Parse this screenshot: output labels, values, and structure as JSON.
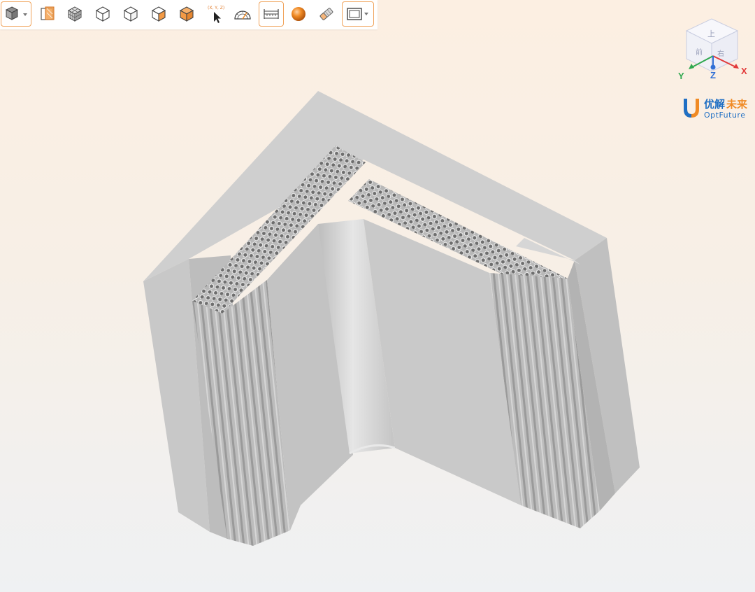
{
  "toolbar": {
    "buttons": [
      {
        "id": "view-cube",
        "icon": "cube-view-icon",
        "dropdown": true
      },
      {
        "id": "section-view",
        "icon": "section-plane-icon"
      },
      {
        "id": "mesh-view",
        "icon": "wireframe-cube-icon"
      },
      {
        "id": "view-front",
        "icon": "cube-outline-icon"
      },
      {
        "id": "view-back",
        "icon": "cube-outline-icon"
      },
      {
        "id": "view-side",
        "icon": "cube-shaded-icon"
      },
      {
        "id": "view-solid",
        "icon": "cube-solid-icon"
      },
      {
        "id": "pick-point",
        "icon": "pointer-coordinate-icon"
      },
      {
        "id": "measure-angle",
        "icon": "protractor-icon"
      },
      {
        "id": "measure-distance",
        "icon": "ruler-icon",
        "active": true
      },
      {
        "id": "material",
        "icon": "sphere-icon"
      },
      {
        "id": "clip",
        "icon": "eraser-icon"
      },
      {
        "id": "display-frame",
        "icon": "frame-icon",
        "dropdown": true
      }
    ],
    "coord_label": "(X, Y, Z)"
  },
  "gizmo": {
    "x_label": "X",
    "y_label": "Y",
    "z_label": "Z",
    "colors": {
      "x": "#e23b3b",
      "y": "#2fa84f",
      "z": "#2f6fd6"
    }
  },
  "logo": {
    "cn_part1": "优解",
    "cn_part2": "未来",
    "en": "OptFuture",
    "colors": {
      "blue": "#1f6fc4",
      "orange": "#f08a24"
    }
  },
  "colors": {
    "accent": "#f0a35a",
    "model": "#c6c6c6"
  }
}
